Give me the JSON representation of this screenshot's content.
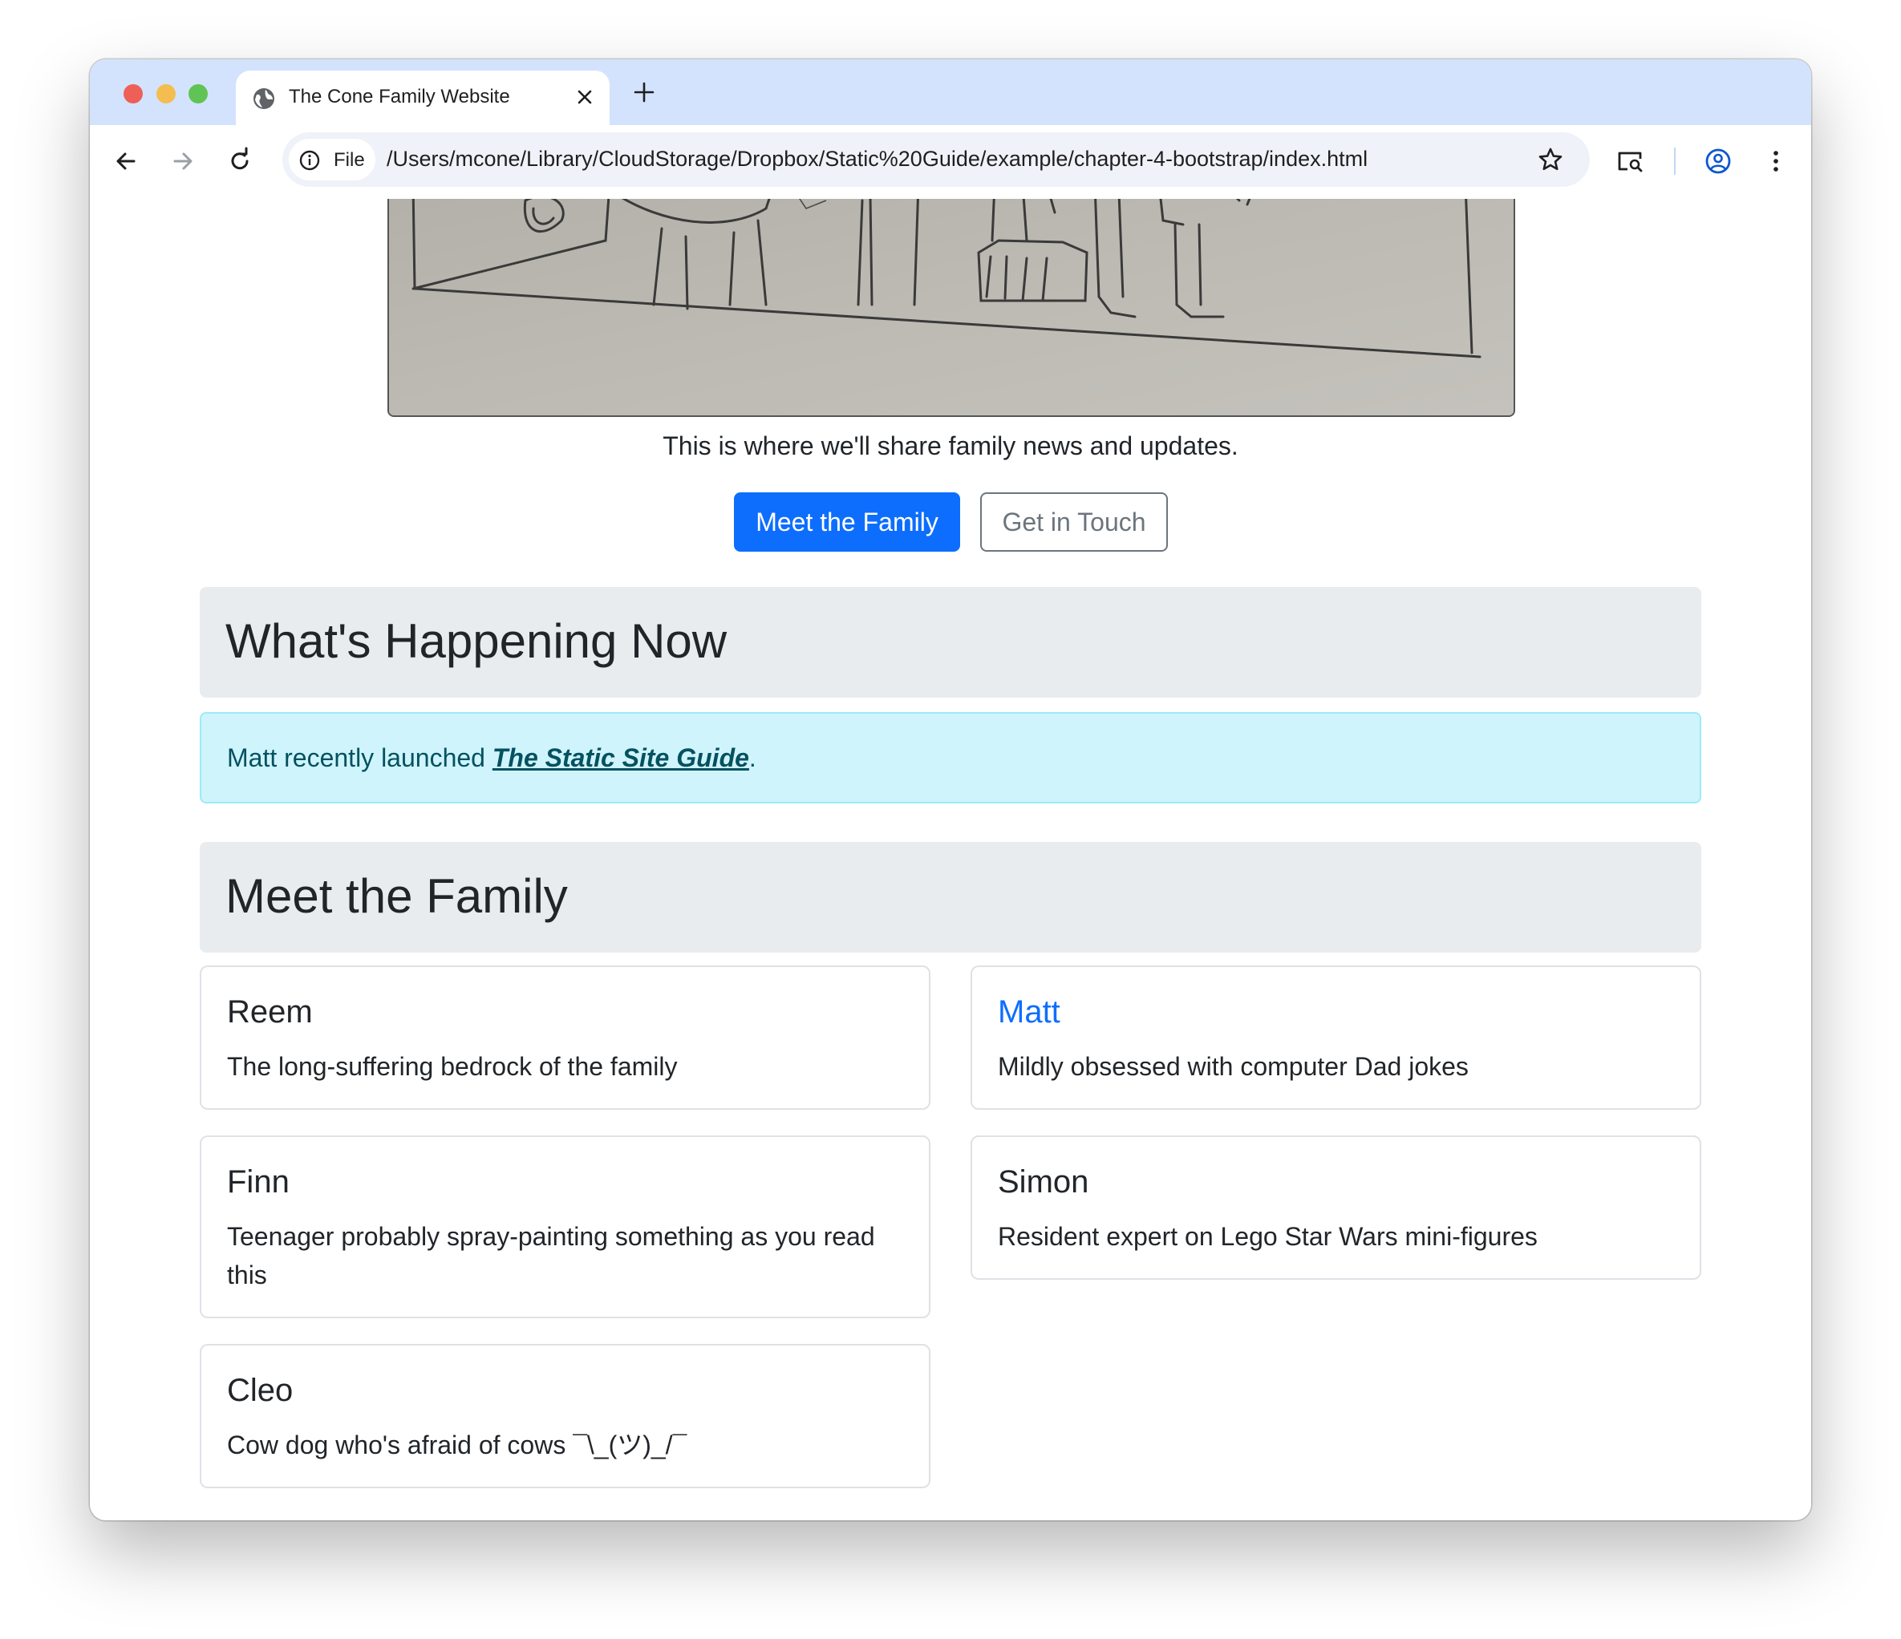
{
  "browser": {
    "tab_title": "The Cone Family Website",
    "file_chip": "File",
    "url": "/Users/mcone/Library/CloudStorage/Dropbox/Static%20Guide/example/chapter-4-bootstrap/index.html"
  },
  "hero": {
    "tagline": "This is where we'll share family news and updates.",
    "primary_button": "Meet the Family",
    "secondary_button": "Get in Touch"
  },
  "news": {
    "heading": "What's Happening Now",
    "alert_prefix": "Matt recently launched ",
    "alert_link": "The Static Site Guide",
    "alert_suffix": "."
  },
  "family": {
    "heading": "Meet the Family",
    "members": [
      {
        "name": "Reem",
        "description": "The long-suffering bedrock of the family"
      },
      {
        "name": "Matt",
        "description": "Mildly obsessed with computer Dad jokes"
      },
      {
        "name": "Finn",
        "description": "Teenager probably spray-painting something as you read this"
      },
      {
        "name": "Simon",
        "description": "Resident expert on Lego Star Wars mini-figures"
      },
      {
        "name": "Cleo",
        "description": "Cow dog who's afraid of cows ¯\\_(ツ)_/¯"
      }
    ]
  },
  "colors": {
    "primary": "#0d6efd",
    "alert_bg": "#cff4fc",
    "alert_text": "#055160",
    "section_bg": "#e9ecef",
    "tabbar_bg": "#d3e3fd"
  },
  "icons": [
    "globe-icon",
    "close-icon",
    "plus-icon",
    "back-icon",
    "forward-icon",
    "reload-icon",
    "info-icon",
    "star-icon",
    "cast-search-icon",
    "profile-icon",
    "menu-icon"
  ]
}
